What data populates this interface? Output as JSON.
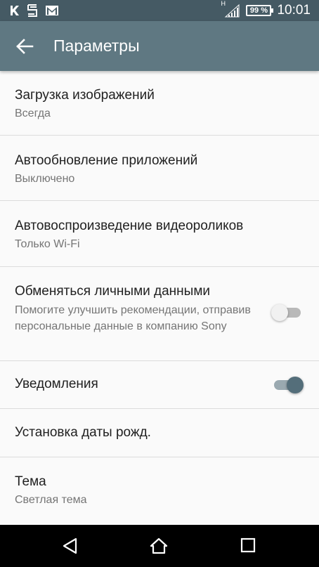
{
  "status_bar": {
    "time": "10:01",
    "battery": "99 %",
    "network_type": "H",
    "icons": [
      "k-notification-icon",
      "s-notification-icon",
      "gmail-icon",
      "signal-icon",
      "battery-icon"
    ]
  },
  "app_bar": {
    "title": "Параметры",
    "color": "#5f7882"
  },
  "settings": [
    {
      "title": "Загрузка изображений",
      "subtitle": "Всегда"
    },
    {
      "title": "Автообновление приложений",
      "subtitle": "Выключено"
    },
    {
      "title": "Автовоспроизведение видеороликов",
      "subtitle": "Только Wi-Fi"
    },
    {
      "title": "Обменяться личными данными",
      "subtitle": "Помогите улучшить рекомендации, отправив персональные данные в компанию Sony",
      "toggle": false
    },
    {
      "title": "Уведомления",
      "toggle": true
    },
    {
      "title": "Установка даты рожд."
    },
    {
      "title": "Тема",
      "subtitle": "Светлая тема"
    }
  ],
  "nav_bar": {
    "icons": [
      "back-triangle-icon",
      "home-icon",
      "recents-icon"
    ]
  }
}
